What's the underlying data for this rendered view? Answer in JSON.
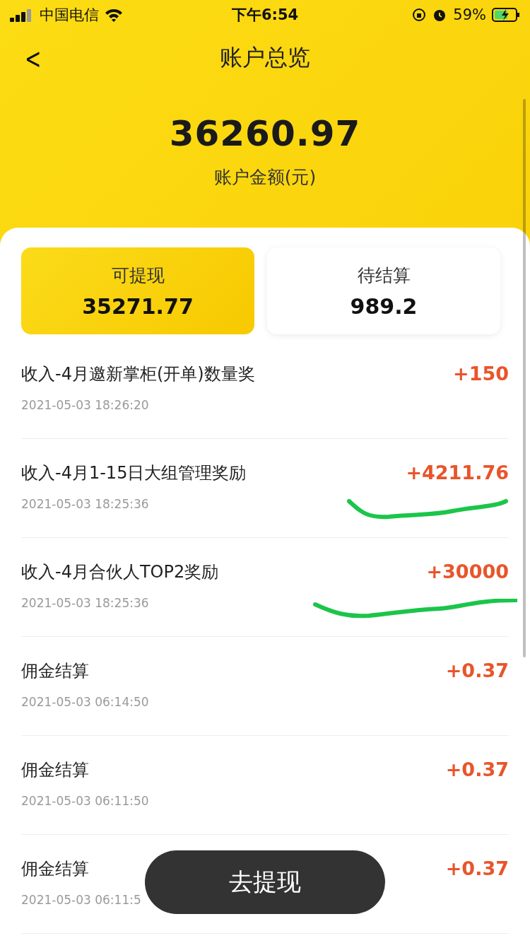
{
  "status_bar": {
    "carrier": "中国电信",
    "time": "下午6:54",
    "battery": "59%"
  },
  "header": {
    "back": "<",
    "title": "账户总览"
  },
  "balance": {
    "amount": "36260.97",
    "label": "账户金额(元)"
  },
  "tiles": [
    {
      "label": "可提现",
      "value": "35271.77",
      "selected": true
    },
    {
      "label": "待结算",
      "value": "989.2",
      "selected": false
    }
  ],
  "transactions": [
    {
      "title": "收入-4月邀新掌柜(开单)数量奖",
      "date": "2021-05-03 18:26:20",
      "amount": "+150",
      "marked": false
    },
    {
      "title": "收入-4月1-15日大组管理奖励",
      "date": "2021-05-03 18:25:36",
      "amount": "+4211.76",
      "marked": true
    },
    {
      "title": "收入-4月合伙人TOP2奖励",
      "date": "2021-05-03 18:25:36",
      "amount": "+30000",
      "marked": true
    },
    {
      "title": "佣金结算",
      "date": "2021-05-03 06:14:50",
      "amount": "+0.37",
      "marked": false
    },
    {
      "title": "佣金结算",
      "date": "2021-05-03 06:11:50",
      "amount": "+0.37",
      "marked": false
    },
    {
      "title": "佣金结算",
      "date": "2021-05-03 06:11:5",
      "amount": "+0.37",
      "marked": false
    }
  ],
  "withdraw_button": "去提现"
}
